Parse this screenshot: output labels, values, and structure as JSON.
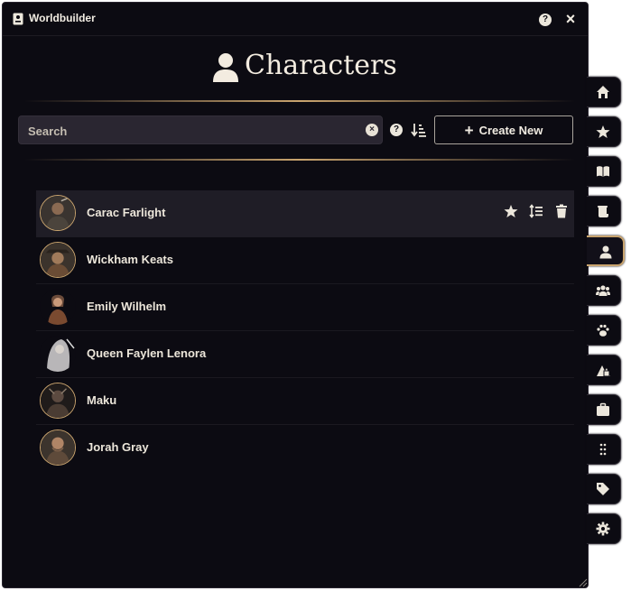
{
  "window": {
    "title": "Worldbuilder"
  },
  "page": {
    "heading": "Characters"
  },
  "search": {
    "placeholder": "Search",
    "value": ""
  },
  "toolbar": {
    "create_label": "Create New",
    "create_plus": "+"
  },
  "characters": [
    {
      "name": "Carac Farlight",
      "hovered": true
    },
    {
      "name": "Wickham Keats"
    },
    {
      "name": "Emily Wilhelm"
    },
    {
      "name": "Queen Faylen Lenora"
    },
    {
      "name": "Maku"
    },
    {
      "name": "Jorah Gray"
    }
  ],
  "sidebar": {
    "tabs": [
      {
        "icon": "home-icon"
      },
      {
        "icon": "star-icon"
      },
      {
        "icon": "book-icon"
      },
      {
        "icon": "scroll-icon"
      },
      {
        "icon": "person-icon",
        "active": true
      },
      {
        "icon": "group-icon"
      },
      {
        "icon": "paw-icon"
      },
      {
        "icon": "map-icon"
      },
      {
        "icon": "briefcase-icon"
      },
      {
        "icon": "grid-icon"
      },
      {
        "icon": "tag-icon"
      },
      {
        "icon": "gear-icon"
      }
    ]
  },
  "colors": {
    "background": "#0c0b12",
    "accent": "#c9a46e",
    "text": "#ece6da",
    "row_hover": "#1f1d26"
  }
}
